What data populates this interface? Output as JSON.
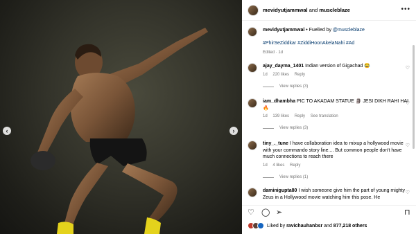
{
  "header": {
    "user1": "mevidyutjammwal",
    "connector": "and",
    "user2": "muscleblaze",
    "more_icon": "more-horizontal-icon"
  },
  "caption": {
    "username": "mevidyutjammwal",
    "bullet": "•",
    "fuelled_prefix": "Fuelled by ",
    "fuelled_mention": "@muscleblaze",
    "hashtags": "#PhirSeZiddkar #ZiddiHoonAkelaNahi #Ad",
    "meta": "Edited · 1d"
  },
  "comments": [
    {
      "username": "ajay_dayma_1401",
      "text": "Indian version of Gigachad 😂",
      "age": "1d",
      "likes": "220 likes",
      "reply": "Reply",
      "view_replies": "View replies (3)"
    },
    {
      "username": "iam_dhambha",
      "text": "PIC TO AKADAM STATUE 🗿 JESI DIKH RAHI HAI 🔥",
      "age": "1d",
      "likes": "139 likes",
      "reply": "Reply",
      "translation": "See translation",
      "view_replies": "View replies (3)"
    },
    {
      "username": "tiny_._tune",
      "text": "I have collaboration idea to mixup a hollywood movie with your commando story line.... But common people don't have much connections to reach there",
      "age": "1d",
      "likes": "4 likes",
      "reply": "Reply",
      "view_replies": "View replies (1)"
    },
    {
      "username": "daminigupta80",
      "text": "I wish someone give him the part of young mighty Zeus in a Hollywood movie watching him this pose. He"
    }
  ],
  "photo": {
    "prev_icon": "‹",
    "next_icon": "›"
  },
  "actions": {
    "liked_prefix": "Liked by ",
    "liked_user": "ravichauhanbsr",
    "liked_and": " and ",
    "liked_count": "877,218 others"
  }
}
